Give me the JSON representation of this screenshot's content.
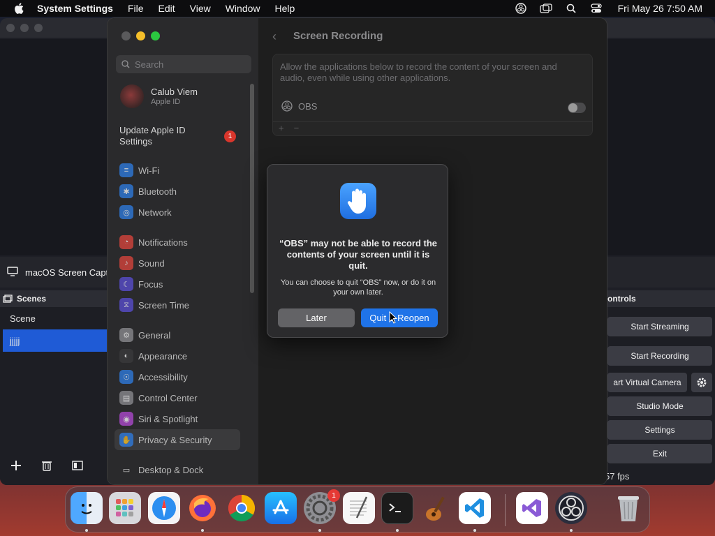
{
  "menubar": {
    "app_name": "System Settings",
    "items": [
      "File",
      "Edit",
      "View",
      "Window",
      "Help"
    ],
    "clock": "Fri May 26  7:50 AM"
  },
  "obs": {
    "source_label": "macOS Screen Captu",
    "scenes_header": "Scenes",
    "scenes": [
      "Scene",
      "jjjjj"
    ],
    "controls_header": "ontrols",
    "controls": [
      "Start Streaming",
      "Start Recording",
      "art Virtual Camera",
      "Studio Mode",
      "Settings",
      "Exit"
    ],
    "fps": "57 fps"
  },
  "settings": {
    "search_placeholder": "Search",
    "account_name": "Calub Viem",
    "account_sub": "Apple ID",
    "update_label": "Update Apple ID Settings",
    "update_badge": "1",
    "nav": [
      {
        "label": "Wi-Fi",
        "color": "#2f7fe6",
        "icon": "wifi-icon"
      },
      {
        "label": "Bluetooth",
        "color": "#2f7fe6",
        "icon": "bluetooth-icon"
      },
      {
        "label": "Network",
        "color": "#2f7fe6",
        "icon": "globe-icon"
      },
      {
        "label": "Notifications",
        "color": "#e0453c",
        "icon": "bell-icon"
      },
      {
        "label": "Sound",
        "color": "#e0453c",
        "icon": "speaker-icon"
      },
      {
        "label": "Focus",
        "color": "#5a4fd6",
        "icon": "moon-icon"
      },
      {
        "label": "Screen Time",
        "color": "#5a4fd6",
        "icon": "hourglass-icon"
      },
      {
        "label": "General",
        "color": "#8e8e93",
        "icon": "gear-icon"
      },
      {
        "label": "Appearance",
        "color": "#3a3a3c",
        "icon": "appearance-icon"
      },
      {
        "label": "Accessibility",
        "color": "#2f7fe6",
        "icon": "accessibility-icon"
      },
      {
        "label": "Control Center",
        "color": "#8e8e93",
        "icon": "control-center-icon"
      },
      {
        "label": "Siri & Spotlight",
        "color": "#b44bd6",
        "icon": "siri-icon"
      },
      {
        "label": "Privacy & Security",
        "color": "#2f7fe6",
        "icon": "hand-icon"
      },
      {
        "label": "Desktop & Dock",
        "color": "#2b2b2d",
        "icon": "dock-icon"
      }
    ],
    "page_title": "Screen Recording",
    "description": "Allow the applications below to record the content of your screen and audio, even while using other applications.",
    "app_entry": "OBS",
    "add_label": "+",
    "remove_label": "−"
  },
  "alert": {
    "heading": "“OBS” may not be able to record the contents of your screen until it is quit.",
    "body": "You can choose to quit “OBS” now, or do it on your own later.",
    "later_label": "Later",
    "quit_label": "Quit & Reopen"
  },
  "dock": {
    "apps": [
      "finder-icon",
      "launchpad-icon",
      "safari-icon",
      "firefox-icon",
      "chrome-icon",
      "app-store-icon",
      "system-settings-icon",
      "textedit-icon",
      "terminal-icon",
      "garageband-icon",
      "vscode-icon",
      "visual-studio-icon",
      "obs-icon",
      "trash-icon"
    ],
    "settings_badge": "1"
  }
}
